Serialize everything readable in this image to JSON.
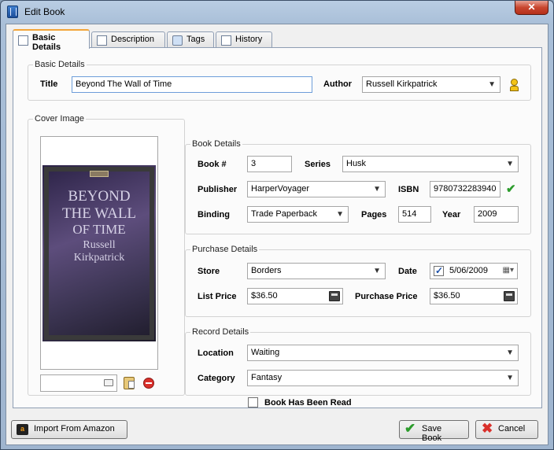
{
  "window": {
    "title": "Edit Book",
    "close_label": "✕"
  },
  "tabs": [
    {
      "label": "Basic Details",
      "active": true
    },
    {
      "label": "Description",
      "active": false
    },
    {
      "label": "Tags",
      "active": false
    },
    {
      "label": "History",
      "active": false
    }
  ],
  "basic": {
    "legend": "Basic Details",
    "title_label": "Title",
    "title_value": "Beyond The Wall of Time",
    "author_label": "Author",
    "author_value": "Russell Kirkpatrick"
  },
  "cover": {
    "legend": "Cover Image",
    "book_title_lines": [
      "BEYOND",
      "THE WALL",
      "OF TIME"
    ],
    "author_lines": [
      "Russell",
      "Kirkpatrick"
    ],
    "path_value": ""
  },
  "book": {
    "legend": "Book Details",
    "booknum_label": "Book #",
    "booknum_value": "3",
    "series_label": "Series",
    "series_value": "Husk",
    "publisher_label": "Publisher",
    "publisher_value": "HarperVoyager",
    "isbn_label": "ISBN",
    "isbn_value": "9780732283940",
    "binding_label": "Binding",
    "binding_value": "Trade Paperback",
    "pages_label": "Pages",
    "pages_value": "514",
    "year_label": "Year",
    "year_value": "2009"
  },
  "purchase": {
    "legend": "Purchase Details",
    "store_label": "Store",
    "store_value": "Borders",
    "date_label": "Date",
    "date_value": "5/06/2009",
    "date_checked": true,
    "listprice_label": "List Price",
    "listprice_value": "$36.50",
    "purchaseprice_label": "Purchase Price",
    "purchaseprice_value": "$36.50"
  },
  "record": {
    "legend": "Record Details",
    "location_label": "Location",
    "location_value": "Waiting",
    "category_label": "Category",
    "category_value": "Fantasy",
    "read_label": "Book Has Been Read",
    "read_checked": false
  },
  "footer": {
    "import_label": "Import From Amazon",
    "save_label": "Save Book",
    "cancel_label": "Cancel"
  },
  "colors": {
    "accent_tab": "#f2a53a",
    "ok_green": "#2c9c2c",
    "remove_red": "#d9302b"
  }
}
